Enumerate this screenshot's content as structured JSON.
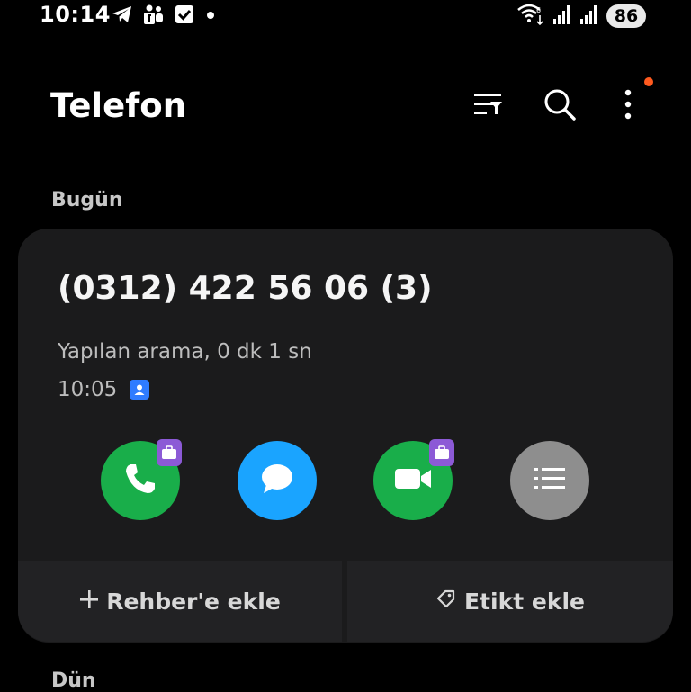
{
  "status_bar": {
    "time": "10:14",
    "left_icons": [
      "telegram-icon",
      "teams-icon",
      "checkbox-icon",
      "dot-icon"
    ],
    "right_icons": [
      "wifi-icon",
      "signal-icon",
      "signal-icon"
    ],
    "battery": "86"
  },
  "header": {
    "title": "Telefon",
    "notification_dot_color": "#ff5a1f"
  },
  "sections": {
    "today": "Bugün",
    "yesterday": "Dün"
  },
  "call_card": {
    "number": "(0312) 422 56 06 (3)",
    "description": "Yapılan arama, 0 dk 1 sn",
    "time": "10:05",
    "actions": [
      {
        "name": "call",
        "icon": "phone-icon",
        "color": "#19ae4a",
        "work_badge": true
      },
      {
        "name": "message",
        "icon": "message-icon",
        "color": "#1aa4ff",
        "work_badge": false
      },
      {
        "name": "video",
        "icon": "video-icon",
        "color": "#19ae4a",
        "work_badge": true
      },
      {
        "name": "details",
        "icon": "list-icon",
        "color": "#8e8e8e",
        "work_badge": false
      }
    ],
    "add_contact_label": "Rehber'e ekle",
    "add_tag_label": "Etikt ekle"
  }
}
